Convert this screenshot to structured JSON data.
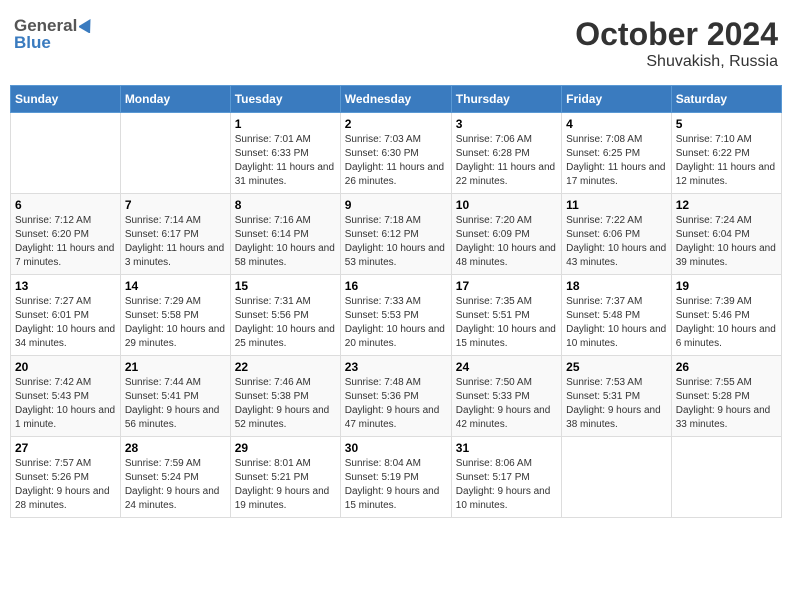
{
  "header": {
    "logo_general": "General",
    "logo_blue": "Blue",
    "title": "October 2024",
    "location": "Shuvakish, Russia"
  },
  "weekdays": [
    "Sunday",
    "Monday",
    "Tuesday",
    "Wednesday",
    "Thursday",
    "Friday",
    "Saturday"
  ],
  "weeks": [
    [
      {
        "day": "",
        "detail": ""
      },
      {
        "day": "",
        "detail": ""
      },
      {
        "day": "1",
        "detail": "Sunrise: 7:01 AM\nSunset: 6:33 PM\nDaylight: 11 hours\nand 31 minutes."
      },
      {
        "day": "2",
        "detail": "Sunrise: 7:03 AM\nSunset: 6:30 PM\nDaylight: 11 hours\nand 26 minutes."
      },
      {
        "day": "3",
        "detail": "Sunrise: 7:06 AM\nSunset: 6:28 PM\nDaylight: 11 hours\nand 22 minutes."
      },
      {
        "day": "4",
        "detail": "Sunrise: 7:08 AM\nSunset: 6:25 PM\nDaylight: 11 hours\nand 17 minutes."
      },
      {
        "day": "5",
        "detail": "Sunrise: 7:10 AM\nSunset: 6:22 PM\nDaylight: 11 hours\nand 12 minutes."
      }
    ],
    [
      {
        "day": "6",
        "detail": "Sunrise: 7:12 AM\nSunset: 6:20 PM\nDaylight: 11 hours\nand 7 minutes."
      },
      {
        "day": "7",
        "detail": "Sunrise: 7:14 AM\nSunset: 6:17 PM\nDaylight: 11 hours\nand 3 minutes."
      },
      {
        "day": "8",
        "detail": "Sunrise: 7:16 AM\nSunset: 6:14 PM\nDaylight: 10 hours\nand 58 minutes."
      },
      {
        "day": "9",
        "detail": "Sunrise: 7:18 AM\nSunset: 6:12 PM\nDaylight: 10 hours\nand 53 minutes."
      },
      {
        "day": "10",
        "detail": "Sunrise: 7:20 AM\nSunset: 6:09 PM\nDaylight: 10 hours\nand 48 minutes."
      },
      {
        "day": "11",
        "detail": "Sunrise: 7:22 AM\nSunset: 6:06 PM\nDaylight: 10 hours\nand 43 minutes."
      },
      {
        "day": "12",
        "detail": "Sunrise: 7:24 AM\nSunset: 6:04 PM\nDaylight: 10 hours\nand 39 minutes."
      }
    ],
    [
      {
        "day": "13",
        "detail": "Sunrise: 7:27 AM\nSunset: 6:01 PM\nDaylight: 10 hours\nand 34 minutes."
      },
      {
        "day": "14",
        "detail": "Sunrise: 7:29 AM\nSunset: 5:58 PM\nDaylight: 10 hours\nand 29 minutes."
      },
      {
        "day": "15",
        "detail": "Sunrise: 7:31 AM\nSunset: 5:56 PM\nDaylight: 10 hours\nand 25 minutes."
      },
      {
        "day": "16",
        "detail": "Sunrise: 7:33 AM\nSunset: 5:53 PM\nDaylight: 10 hours\nand 20 minutes."
      },
      {
        "day": "17",
        "detail": "Sunrise: 7:35 AM\nSunset: 5:51 PM\nDaylight: 10 hours\nand 15 minutes."
      },
      {
        "day": "18",
        "detail": "Sunrise: 7:37 AM\nSunset: 5:48 PM\nDaylight: 10 hours\nand 10 minutes."
      },
      {
        "day": "19",
        "detail": "Sunrise: 7:39 AM\nSunset: 5:46 PM\nDaylight: 10 hours\nand 6 minutes."
      }
    ],
    [
      {
        "day": "20",
        "detail": "Sunrise: 7:42 AM\nSunset: 5:43 PM\nDaylight: 10 hours\nand 1 minute."
      },
      {
        "day": "21",
        "detail": "Sunrise: 7:44 AM\nSunset: 5:41 PM\nDaylight: 9 hours\nand 56 minutes."
      },
      {
        "day": "22",
        "detail": "Sunrise: 7:46 AM\nSunset: 5:38 PM\nDaylight: 9 hours\nand 52 minutes."
      },
      {
        "day": "23",
        "detail": "Sunrise: 7:48 AM\nSunset: 5:36 PM\nDaylight: 9 hours\nand 47 minutes."
      },
      {
        "day": "24",
        "detail": "Sunrise: 7:50 AM\nSunset: 5:33 PM\nDaylight: 9 hours\nand 42 minutes."
      },
      {
        "day": "25",
        "detail": "Sunrise: 7:53 AM\nSunset: 5:31 PM\nDaylight: 9 hours\nand 38 minutes."
      },
      {
        "day": "26",
        "detail": "Sunrise: 7:55 AM\nSunset: 5:28 PM\nDaylight: 9 hours\nand 33 minutes."
      }
    ],
    [
      {
        "day": "27",
        "detail": "Sunrise: 7:57 AM\nSunset: 5:26 PM\nDaylight: 9 hours\nand 28 minutes."
      },
      {
        "day": "28",
        "detail": "Sunrise: 7:59 AM\nSunset: 5:24 PM\nDaylight: 9 hours\nand 24 minutes."
      },
      {
        "day": "29",
        "detail": "Sunrise: 8:01 AM\nSunset: 5:21 PM\nDaylight: 9 hours\nand 19 minutes."
      },
      {
        "day": "30",
        "detail": "Sunrise: 8:04 AM\nSunset: 5:19 PM\nDaylight: 9 hours\nand 15 minutes."
      },
      {
        "day": "31",
        "detail": "Sunrise: 8:06 AM\nSunset: 5:17 PM\nDaylight: 9 hours\nand 10 minutes."
      },
      {
        "day": "",
        "detail": ""
      },
      {
        "day": "",
        "detail": ""
      }
    ]
  ]
}
